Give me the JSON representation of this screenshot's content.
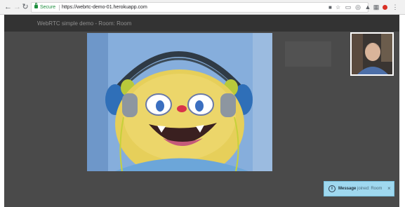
{
  "browser": {
    "secure_label": "Secure",
    "url": "https://webrtc-demo-01.herokuapp.com"
  },
  "app": {
    "title": "WebRTC simple demo - Room: Room"
  },
  "toast": {
    "title": "Message",
    "message": "joined: Room",
    "close": "×"
  },
  "icons": {
    "back": "back-arrow-icon",
    "forward": "forward-arrow-icon",
    "reload": "reload-icon",
    "lock": "lock-icon",
    "video_camera": "video-camera-icon",
    "star": "star-icon",
    "cast": "cast-icon",
    "extensions": [
      "screen-icon",
      "person-icon",
      "puzzle-icon",
      "adblock-icon"
    ],
    "menu": "more-vert-icon",
    "info": "info-icon"
  },
  "colors": {
    "secure_green": "#1e8e3e",
    "app_background": "#4a4a4a",
    "header_background": "#333333",
    "toast_background": "#9fd8ef"
  }
}
